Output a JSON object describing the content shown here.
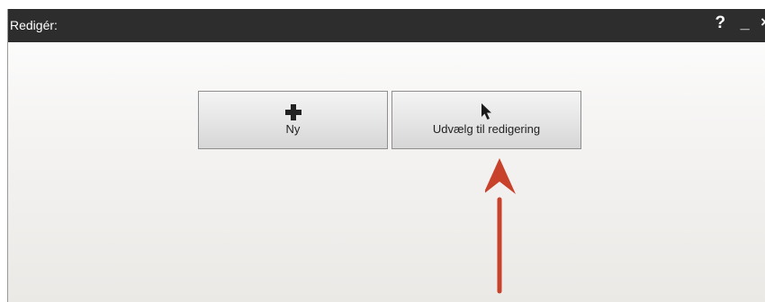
{
  "window": {
    "title": "Redigér:",
    "controls": {
      "help": "?",
      "minimize": "_",
      "close": "×"
    }
  },
  "buttons": {
    "new": {
      "label": "Ny",
      "icon": "plus-icon"
    },
    "select": {
      "label": "Udvælg til redigering",
      "icon": "cursor-icon"
    }
  },
  "annotation": {
    "icon": "red-arrow-up",
    "color": "#c8412a"
  }
}
